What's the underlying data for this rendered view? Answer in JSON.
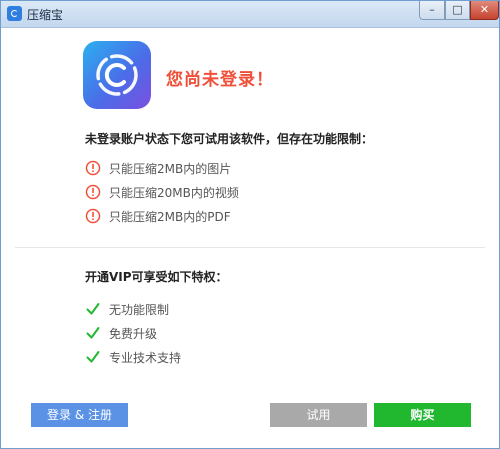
{
  "window": {
    "title": "压缩宝",
    "min_glyph": "–",
    "max_glyph": "□",
    "close_glyph": "✕"
  },
  "header": {
    "headline": "您尚未登录！"
  },
  "limits": {
    "title": "未登录账户状态下您可试用该软件，但存在功能限制：",
    "items": [
      {
        "label": "只能压缩2MB内的图片"
      },
      {
        "label": "只能压缩20MB内的视频"
      },
      {
        "label": "只能压缩2MB内的PDF"
      }
    ]
  },
  "vip": {
    "title": "开通VIP可享受如下特权：",
    "items": [
      {
        "label": "无功能限制"
      },
      {
        "label": "免费升级"
      },
      {
        "label": "专业技术支持"
      }
    ]
  },
  "buttons": {
    "login": "登录 & 注册",
    "trial": "试用",
    "buy": "购买"
  },
  "colors": {
    "accent_red": "#f0503a",
    "check_green": "#21b830",
    "login_blue": "#5b92e6",
    "trial_gray": "#a9a9a9"
  }
}
